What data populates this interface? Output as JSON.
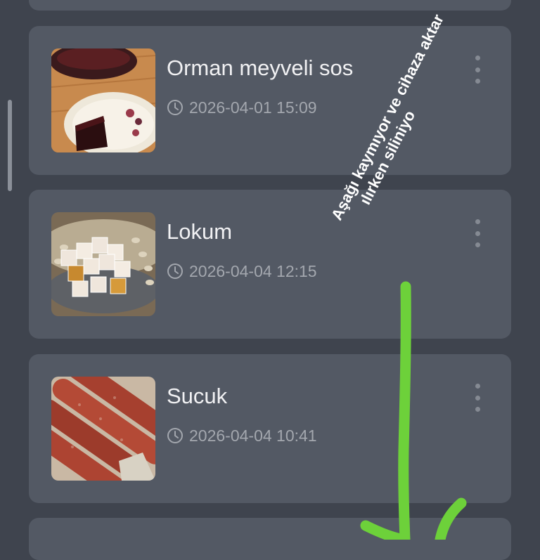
{
  "recipes": [
    {
      "title": "Orman meyveli sos",
      "timestamp": "2026-04-01 15:09",
      "image": "berry-sauce-cake-photo"
    },
    {
      "title": "Lokum",
      "timestamp": "2026-04-04 12:15",
      "image": "turkish-delight-photo"
    },
    {
      "title": "Sucuk",
      "timestamp": "2026-04-04 10:41",
      "image": "sucuk-sausage-photo"
    }
  ],
  "annotation": {
    "line1": "Aşağı kaymıyor ve cihaza aktar",
    "line2": "ılırken siliniyo",
    "color": "#6dd13a"
  },
  "icons": {
    "clock": "clock-icon",
    "more": "more-vertical-icon"
  },
  "colors": {
    "background": "#3f444e",
    "card": "#535964",
    "title": "#f1f1f3",
    "meta": "#a3a7ae"
  }
}
